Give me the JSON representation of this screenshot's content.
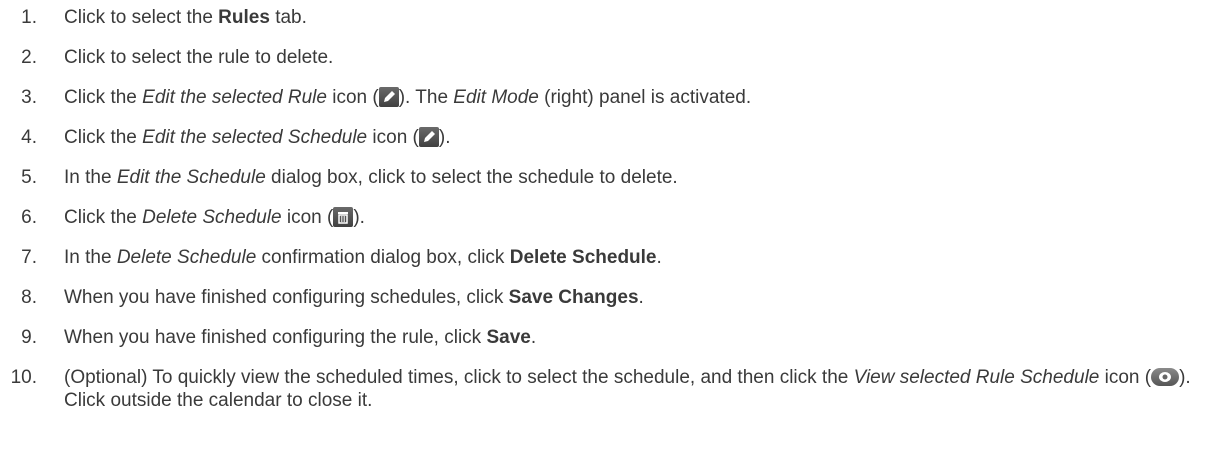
{
  "steps": [
    {
      "num": "1.",
      "a": "Click to select the ",
      "b": "Rules",
      "c": " tab."
    },
    {
      "num": "2.",
      "a": "Click to select the rule to delete."
    },
    {
      "num": "3.",
      "a": "Click the ",
      "i": "Edit the selected Rule",
      "c": " icon (",
      "icon": "pencil-icon",
      "d": "). The ",
      "i2": "Edit Mode",
      "e": " (right) panel is activated."
    },
    {
      "num": "4.",
      "a": "Click the ",
      "i": "Edit the selected Schedule",
      "c": " icon (",
      "icon": "pencil-icon",
      "d": ")."
    },
    {
      "num": "5.",
      "a": "In the ",
      "i": "Edit the Schedule",
      "c": " dialog box, click to select the schedule to delete."
    },
    {
      "num": "6.",
      "a": "Click the ",
      "i": "Delete Schedule",
      "c": " icon (",
      "icon": "trash-icon",
      "d": ")."
    },
    {
      "num": "7.",
      "a": "In the ",
      "i": "Delete Schedule",
      "c": " confirmation dialog box, click ",
      "b": "Delete Schedule",
      "d": "."
    },
    {
      "num": "8.",
      "a": "When you have finished configuring schedules, click ",
      "b": "Save Changes",
      "c": "."
    },
    {
      "num": "9.",
      "a": "When you have finished configuring the rule, click ",
      "b": "Save",
      "c": "."
    },
    {
      "num": "10.",
      "a": "(Optional) To quickly view the scheduled times, click to select the schedule, and then click the ",
      "i": "View selected Rule Schedule",
      "c": " icon (",
      "icon": "eye-icon",
      "d": "). Click outside the calendar to close it."
    }
  ],
  "colors": {
    "text": "#3a3a3a",
    "icon": "#505050"
  }
}
